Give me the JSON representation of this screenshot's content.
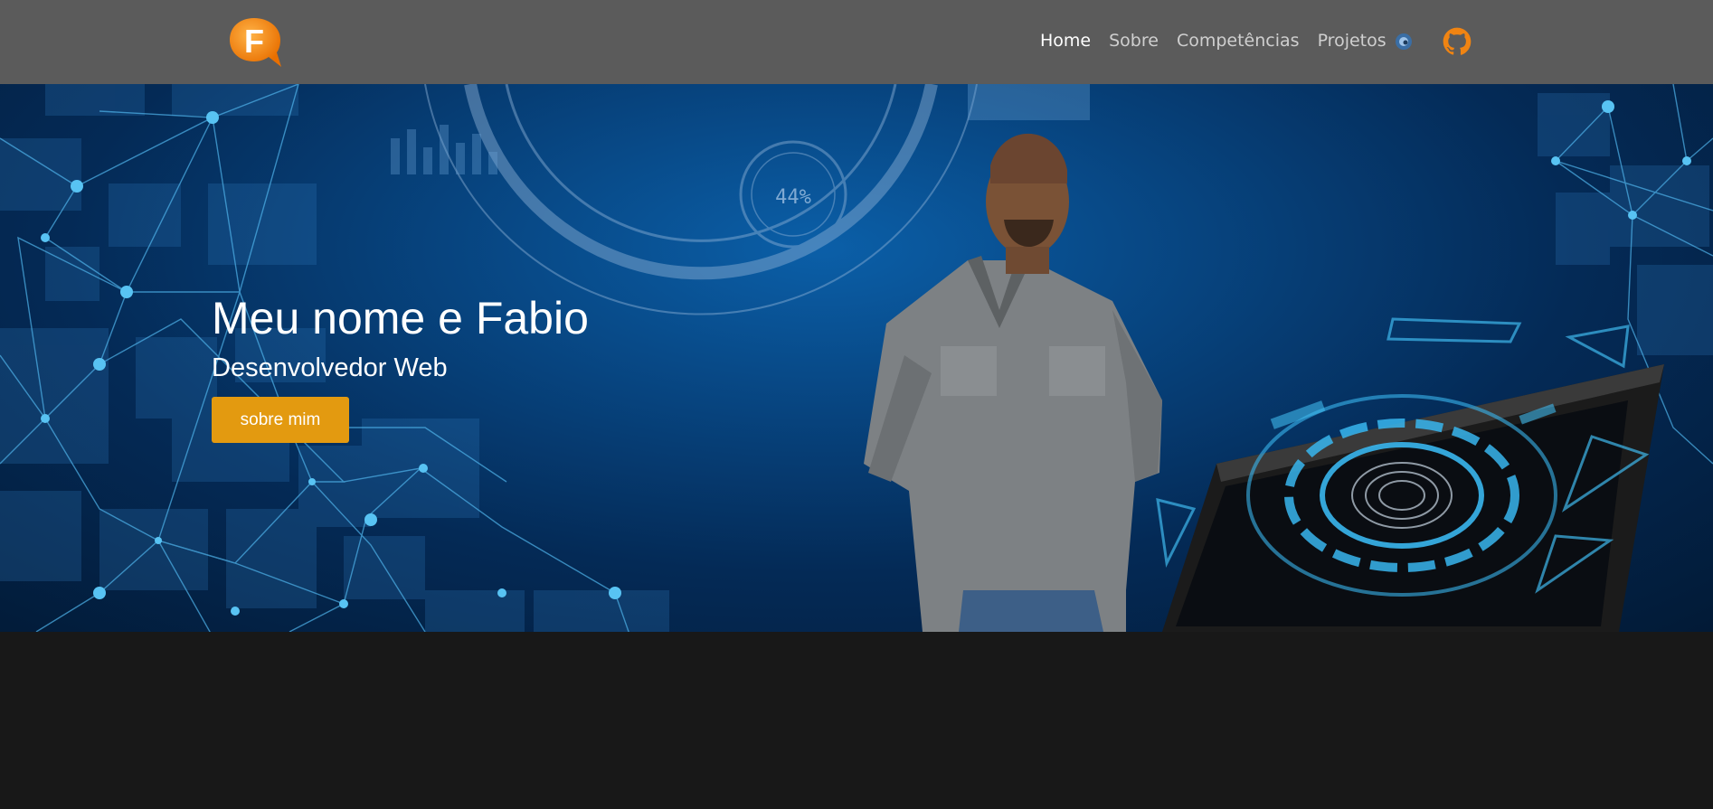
{
  "header": {
    "logo": {
      "letter": "F",
      "icon": "f-speech-bubble-logo"
    },
    "nav": [
      {
        "label": "Home",
        "active": true
      },
      {
        "label": "Sobre",
        "active": false
      },
      {
        "label": "Competências",
        "active": false
      },
      {
        "label": "Projetos",
        "active": false
      }
    ],
    "icons": [
      {
        "name": "small-logo-icon"
      },
      {
        "name": "github-icon"
      }
    ]
  },
  "hero": {
    "title": "Meu nome e Fabio",
    "subtitle": "Desenvolvedor Web",
    "button_label": "sobre mim",
    "hud_percent": "44%",
    "photo": "portrait of man in grey denim shirt"
  },
  "colors": {
    "navbar": "#5b5b5b",
    "accent": "#e39a10",
    "logo_orange": "#f28a0f",
    "page_bg": "#181818",
    "hero_blue": "#07447f"
  }
}
